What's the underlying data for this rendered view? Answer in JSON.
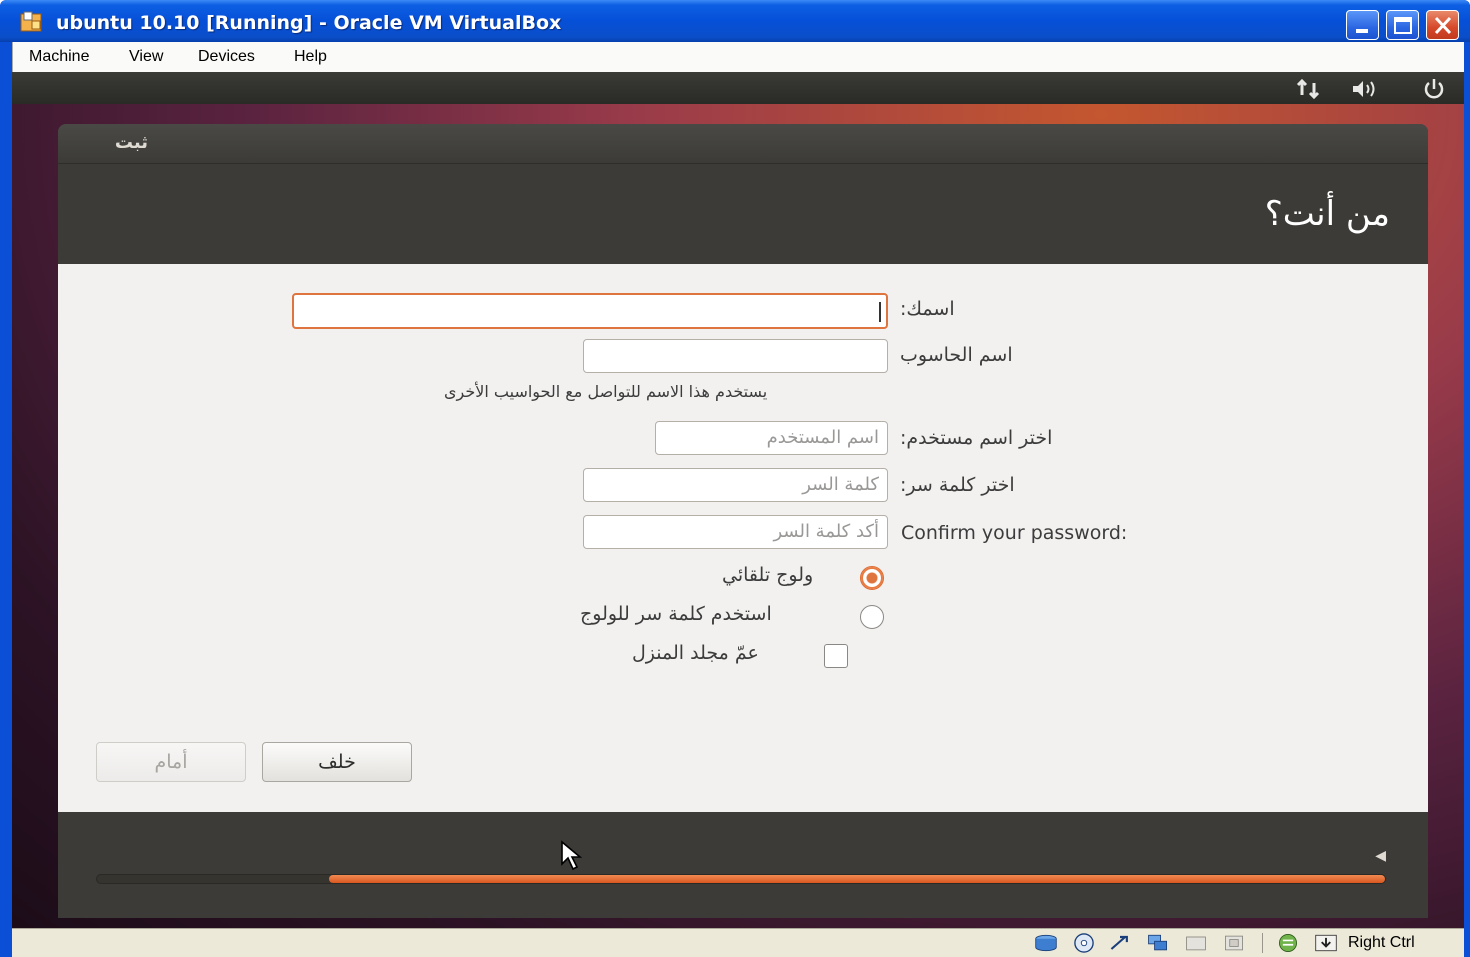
{
  "window": {
    "title": "ubuntu 10.10 [Running] - Oracle VM VirtualBox"
  },
  "menubar": {
    "items": [
      "Machine",
      "View",
      "Devices",
      "Help"
    ]
  },
  "installer": {
    "dialog_title": "ثبت",
    "page_title": "من أنت؟",
    "fields": {
      "name_label": "اسمك:",
      "name_value": "",
      "computer_label": "اسم الحاسوب",
      "computer_value": "",
      "computer_hint": "يستخدم هذا الاسم للتواصل مع الحواسيب الأخرى",
      "username_label": "اختر اسم مستخدم:",
      "username_placeholder": "اسم المستخدم",
      "password_label": "اختر كلمة سر:",
      "password_placeholder": "كلمة السر",
      "confirm_label": "Confirm your password:",
      "confirm_placeholder": "أكد كلمة السر"
    },
    "options": {
      "auto_login": "ولوج تلقائي",
      "require_password": "استخدم كلمة سر للولوج",
      "encrypt_home": "عمّ مجلد المنزل"
    },
    "buttons": {
      "forward": "أمام",
      "back": "خلف"
    },
    "progress": 0.82
  },
  "statusbar": {
    "host_key": "Right Ctrl"
  }
}
